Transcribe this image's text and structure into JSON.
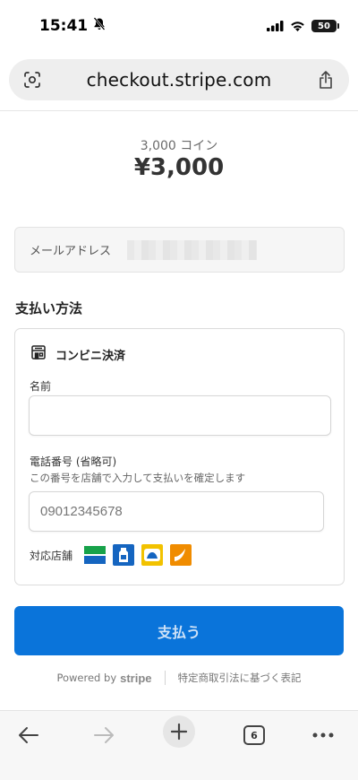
{
  "status_bar": {
    "time": "15:41",
    "battery": "50"
  },
  "browser": {
    "url": "checkout.stripe.com",
    "tab_count": "6"
  },
  "product": {
    "name": "3,000 コイン",
    "amount": "¥3,000"
  },
  "email": {
    "label": "メールアドレス"
  },
  "payment": {
    "section_title": "支払い方法",
    "method_label": "コンビニ決済",
    "name_label": "名前",
    "name_value": "",
    "phone_label": "電話番号 (省略可)",
    "phone_help": "この番号を店舗で入力して支払いを確定します",
    "phone_placeholder": "09012345678",
    "stores_label": "対応店舗"
  },
  "pay_button": {
    "label": "支払う"
  },
  "footer": {
    "powered_by": "Powered by",
    "brand": "stripe",
    "legal_link": "特定商取引法に基づく表記"
  },
  "colors": {
    "accent": "#0a74da"
  },
  "icons": [
    "bell-slash-icon",
    "cellular-signal-icon",
    "wifi-icon",
    "battery-icon",
    "page-scan-icon",
    "share-icon",
    "convenience-store-icon",
    "back-arrow-icon",
    "forward-arrow-icon",
    "plus-icon",
    "tabs-icon",
    "more-icon"
  ]
}
